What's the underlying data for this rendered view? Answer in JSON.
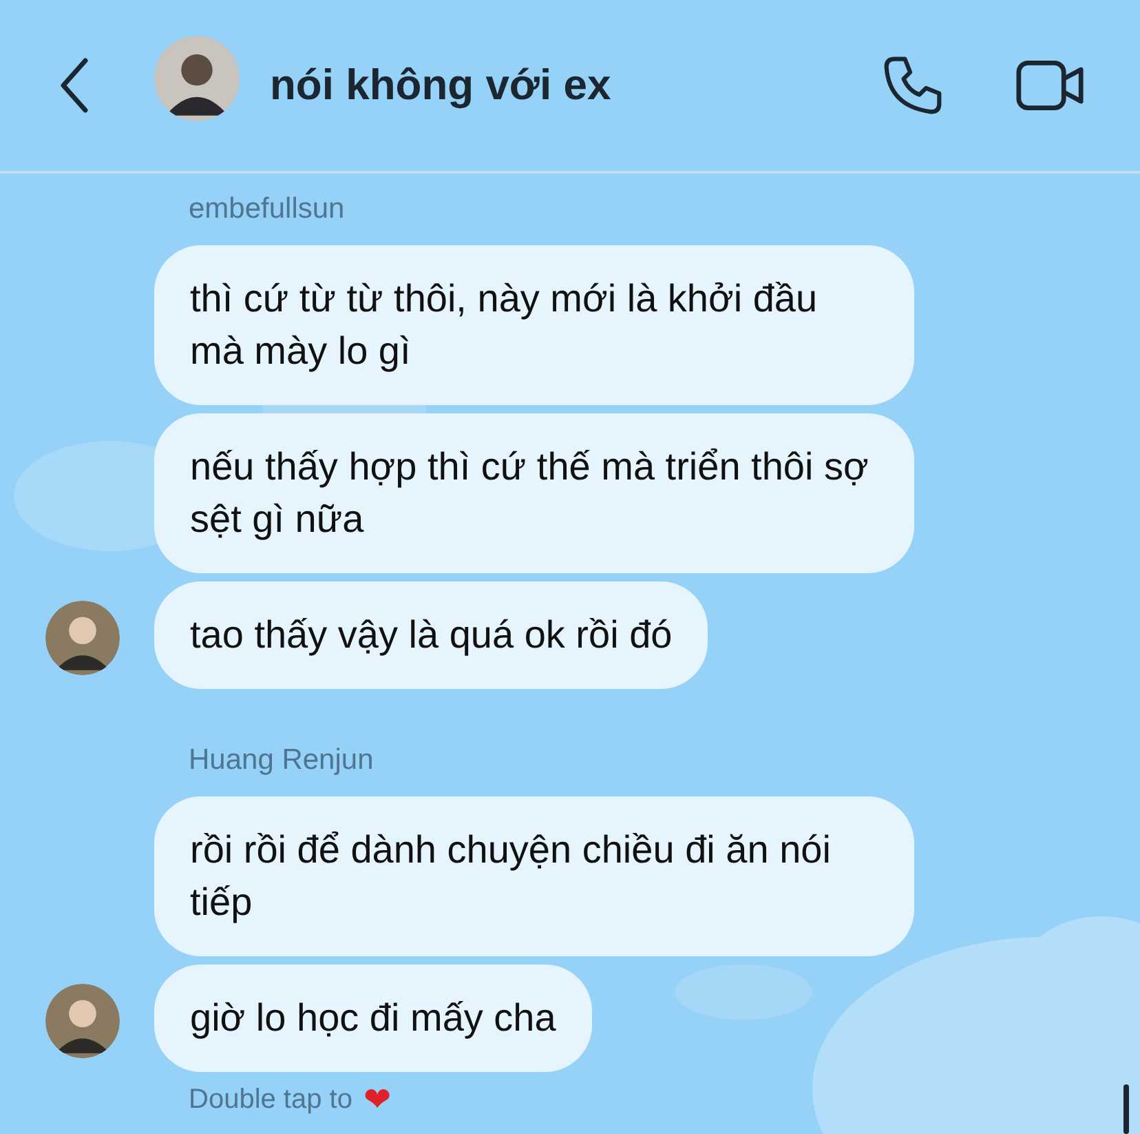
{
  "header": {
    "title": "nói không với ex"
  },
  "groups": [
    {
      "sender": "embefullsun",
      "messages": [
        "thì cứ từ từ thôi, này mới là khởi đầu mà mày lo gì",
        "nếu thấy hợp thì cứ thế mà triển thôi sợ sệt gì nữa",
        "tao thấy vậy là quá ok rồi đó"
      ]
    },
    {
      "sender": "Huang Renjun",
      "messages": [
        "rồi rồi để dành chuyện chiều đi ăn nói tiếp",
        "giờ lo học đi mấy cha"
      ]
    }
  ],
  "hint": {
    "text": "Double tap to",
    "emoji": "❤"
  }
}
